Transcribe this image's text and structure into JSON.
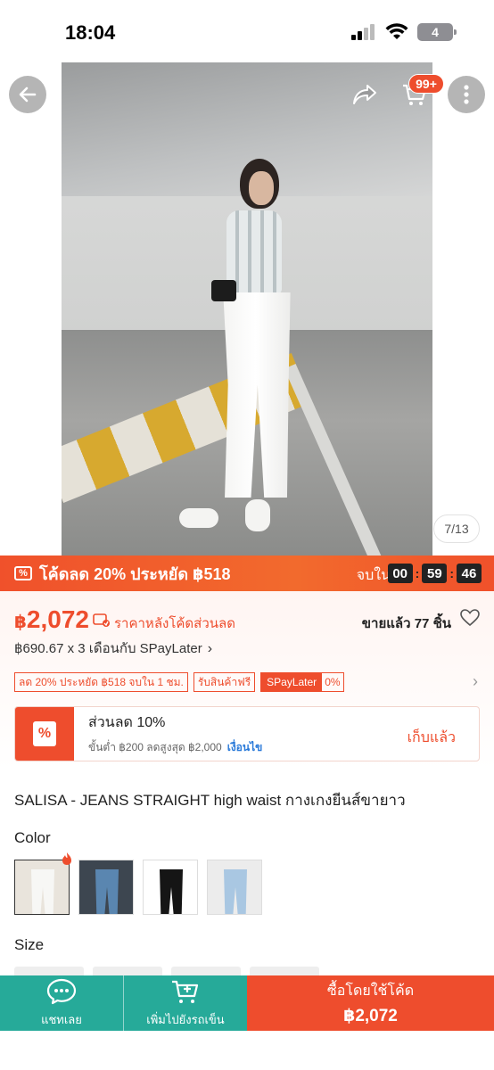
{
  "status_bar": {
    "time": "18:04",
    "battery": "4"
  },
  "gallery": {
    "counter": "7/13",
    "cart_badge": "99+"
  },
  "flash": {
    "title": "โค้ดลด 20% ประหยัด ฿518",
    "ends_label": "จบใน",
    "hours": "00",
    "minutes": "59",
    "seconds": "46"
  },
  "price": {
    "currency": "฿",
    "amount": "2,072",
    "code_label": "ราคาหลังโค้ดส่วนลด",
    "sold": "ขายแล้ว 77 ชิ้น",
    "installment": "฿690.67 x 3 เดือนกับ SPayLater"
  },
  "tags": {
    "discount": "ลด 20% ประหยัด ฿518 จบใน 1 ชม.",
    "free": "รับสินค้าฟรี",
    "spay": "SPayLater",
    "spay_rate": "0%"
  },
  "voucher": {
    "icon": "%",
    "title": "ส่วนลด 10%",
    "subtitle": "ขั้นต่ำ ฿200 ลดสูงสุด ฿2,000",
    "condition": "เงื่อนไข",
    "claim": "เก็บแล้ว"
  },
  "product": {
    "title": "SALISA - JEANS STRAIGHT high waist กางเกงยีนส์ขายาว",
    "color_label": "Color",
    "size_label": "Size"
  },
  "bottom_bar": {
    "chat": "แชทเลย",
    "add_cart": "เพิ่มไปยังรถเข็น",
    "buy": "ซื้อโดยใช้โค้ด",
    "buy_price": "฿2,072"
  },
  "colors": {
    "accent": "#ee4d2d",
    "teal": "#26aa99"
  }
}
